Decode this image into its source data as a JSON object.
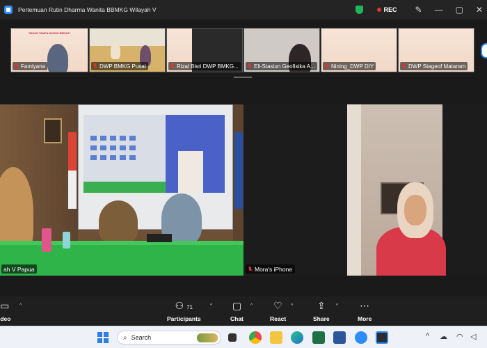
{
  "window": {
    "title": "Pertemuan Rutin Dharma Wanita BBMKG Wilayah V",
    "recording_label": "REC",
    "colors": {
      "zoom_blue": "#2d8cff",
      "rec_red": "#e03232",
      "shield_green": "#22b45a",
      "table_green": "#2fb44a"
    }
  },
  "gallery": [
    {
      "label": "Famiyana",
      "muted": true,
      "style": "banner"
    },
    {
      "label": "DWP BMKG Pusat",
      "muted": true,
      "style": "video"
    },
    {
      "label": "Rizal Bisri DWP BMKG...",
      "muted": true,
      "style": "banner"
    },
    {
      "label": "Eli-Stasiun Geofisika A...",
      "muted": true,
      "style": "video"
    },
    {
      "label": "Nining_DWP DIY",
      "muted": true,
      "style": "banner"
    },
    {
      "label": "DWP Stageof Mataram",
      "muted": true,
      "style": "banner"
    }
  ],
  "banner_text": "\"BISAS TAMPA HARUS BERAS\"",
  "main": [
    {
      "label": "ah V Papua",
      "muted": false
    },
    {
      "label": "Mora's iPhone",
      "muted": true
    }
  ],
  "toolbar": {
    "video_label": "ideo",
    "participants_label": "Participants",
    "participants_count": "71",
    "chat_label": "Chat",
    "react_label": "React",
    "share_label": "Share",
    "more_label": "More"
  },
  "taskbar": {
    "search_placeholder": "Search"
  },
  "icons": [
    "zoom-logo-icon",
    "shield-icon",
    "record-dot-icon",
    "wand-icon",
    "minimize-icon",
    "maximize-icon",
    "close-icon",
    "mic-off-icon",
    "video-icon",
    "participants-icon",
    "chat-icon",
    "react-heart-icon",
    "share-icon",
    "more-icon",
    "windows-start-icon",
    "search-icon",
    "chrome-icon",
    "wifi-icon",
    "battery-icon",
    "volume-icon"
  ]
}
